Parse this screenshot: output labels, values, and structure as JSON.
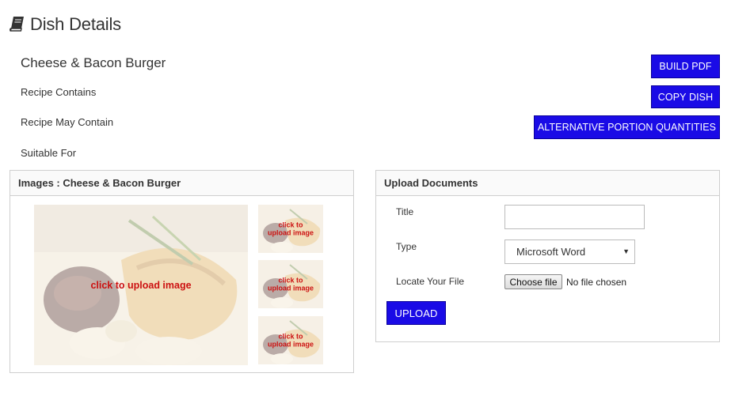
{
  "header": {
    "title": "Dish Details",
    "icon": "book-icon"
  },
  "dish": {
    "name": "Cheese & Bacon Burger",
    "recipe_contains": "Recipe Contains",
    "recipe_may_contain": "Recipe May Contain",
    "suitable_for": "Suitable For"
  },
  "actions": {
    "build_pdf": "BUILD PDF",
    "copy_dish": "COPY DISH",
    "alternative_portions": "ALTERNATIVE PORTION QUANTITIES"
  },
  "images_panel": {
    "title": "Images : Cheese & Bacon Burger",
    "main_cta": "click to upload image",
    "thumb_cta_line1": "click to",
    "thumb_cta_line2": "upload image"
  },
  "upload_panel": {
    "title": "Upload Documents",
    "title_label": "Title",
    "title_value": "",
    "type_label": "Type",
    "type_selected": "Microsoft Word",
    "file_label": "Locate Your File",
    "choose_file": "Choose file",
    "file_status": "No file chosen",
    "upload_button": "UPLOAD"
  },
  "colors": {
    "accent": "#1a0be6",
    "cta": "#cc1111",
    "border": "#cfcfcf"
  }
}
